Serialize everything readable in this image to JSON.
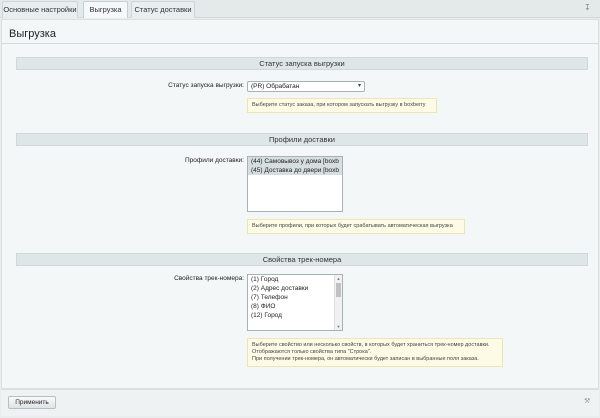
{
  "tabs": [
    {
      "label": "Основные настройки",
      "active": false
    },
    {
      "label": "Выгрузка",
      "active": true
    },
    {
      "label": "Статус доставки",
      "active": false
    }
  ],
  "page_title": "Выгрузка",
  "sections": {
    "status": {
      "header": "Статус запуска выгрузки",
      "label": "Статус запуска выгрузки:",
      "selected": "(PR) Обрабатан",
      "hint": "Выберите статус заказа, при котором запускать выгрузку в boxberry"
    },
    "profiles": {
      "header": "Профили доставки",
      "label": "Профили доставки:",
      "options": [
        "(44) Самовывоз у дома [boxb",
        "(45) Доставка до двери [boxb"
      ],
      "hint": "Выберите профили, при которых будет срабатывать автоматическая выгрузка"
    },
    "track": {
      "header": "Свойства трек-номера",
      "label": "Свойства трек-номера:",
      "options": [
        "(1) Город",
        "(2) Адрес доставки",
        "(7) Телефон",
        "(8) ФИО",
        "(12) Город"
      ],
      "hint_lines": [
        "Выберите свойство или несколько свойств, в которых будет храниться трек-номер доставки.",
        "Отображаются только свойства типа \"Строка\".",
        "При получении трек-номера, он автоматически будет записан в выбранные поля заказа."
      ]
    }
  },
  "footer": {
    "apply_label": "Применить"
  },
  "icons": {
    "pin": "pin-icon",
    "wrench": "wrench-icon",
    "dropdown": "chevron-down-icon"
  }
}
